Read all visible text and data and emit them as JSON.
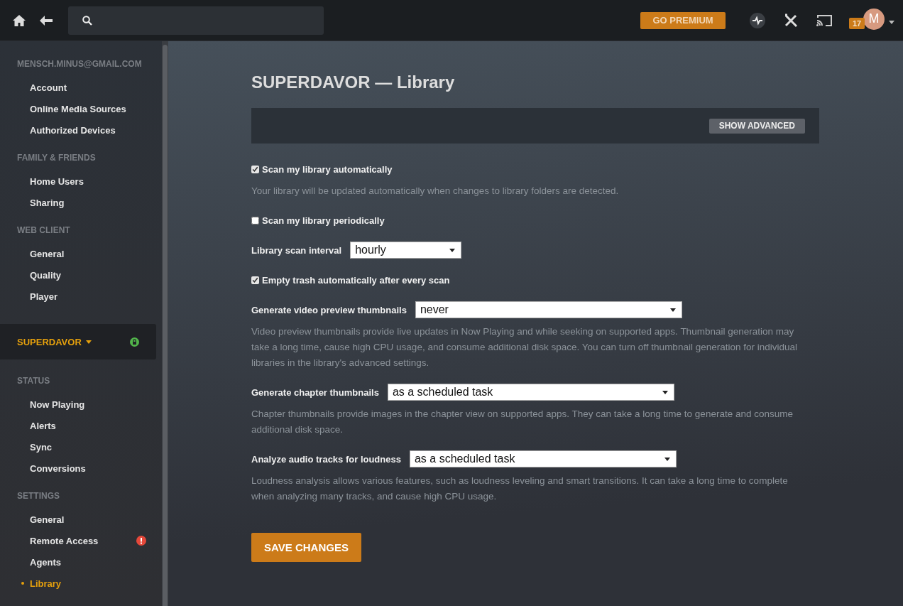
{
  "topbar": {
    "premium_button": "GO PREMIUM",
    "notification_count": "17",
    "avatar_initial": "M"
  },
  "sidebar": {
    "sections": [
      {
        "header": "MENSCH.MINUS@GMAIL.COM",
        "items": [
          {
            "label": "Account",
            "selected": false,
            "alert": false
          },
          {
            "label": "Online Media Sources",
            "selected": false,
            "alert": false
          },
          {
            "label": "Authorized Devices",
            "selected": false,
            "alert": false
          }
        ]
      },
      {
        "header": "FAMILY & FRIENDS",
        "items": [
          {
            "label": "Home Users",
            "selected": false,
            "alert": false
          },
          {
            "label": "Sharing",
            "selected": false,
            "alert": false
          }
        ]
      },
      {
        "header": "WEB CLIENT",
        "items": [
          {
            "label": "General",
            "selected": false,
            "alert": false
          },
          {
            "label": "Quality",
            "selected": false,
            "alert": false
          },
          {
            "label": "Player",
            "selected": false,
            "alert": false
          }
        ]
      }
    ],
    "server": {
      "name": "SUPERDAVOR"
    },
    "server_sections": [
      {
        "header": "STATUS",
        "items": [
          {
            "label": "Now Playing",
            "selected": false,
            "alert": false
          },
          {
            "label": "Alerts",
            "selected": false,
            "alert": false
          },
          {
            "label": "Sync",
            "selected": false,
            "alert": false
          },
          {
            "label": "Conversions",
            "selected": false,
            "alert": false
          }
        ]
      },
      {
        "header": "SETTINGS",
        "items": [
          {
            "label": "General",
            "selected": false,
            "alert": false
          },
          {
            "label": "Remote Access",
            "selected": false,
            "alert": true
          },
          {
            "label": "Agents",
            "selected": false,
            "alert": false
          },
          {
            "label": "Library",
            "selected": true,
            "alert": false
          }
        ]
      }
    ]
  },
  "page": {
    "title": "SUPERDAVOR — Library",
    "show_advanced_button": "SHOW ADVANCED",
    "settings": [
      {
        "kind": "checkbox",
        "label": "Scan my library automatically",
        "checked": true,
        "description": "Your library will be updated automatically when changes to library folders are detected."
      },
      {
        "kind": "checkbox",
        "label": "Scan my library periodically",
        "checked": false
      },
      {
        "kind": "select",
        "label": "Library scan interval",
        "value": "hourly"
      },
      {
        "kind": "checkbox",
        "label": "Empty trash automatically after every scan",
        "checked": true
      },
      {
        "kind": "select",
        "label": "Generate video preview thumbnails",
        "value": "never",
        "description": "Video preview thumbnails provide live updates in Now Playing and while seeking on supported apps. Thumbnail generation may take a long time, cause high CPU usage, and consume additional disk space. You can turn off thumbnail generation for individual libraries in the library's advanced settings."
      },
      {
        "kind": "select",
        "label": "Generate chapter thumbnails",
        "value": "as a scheduled task",
        "description": "Chapter thumbnails provide images in the chapter view on supported apps. They can take a long time to generate and consume additional disk space."
      },
      {
        "kind": "select",
        "label": "Analyze audio tracks for loudness",
        "value": "as a scheduled task",
        "description": "Loudness analysis allows various features, such as loudness leveling and smart transitions. It can take a long time to complete when analyzing many tracks, and cause high CPU usage."
      }
    ],
    "save_button": "SAVE CHANGES"
  }
}
